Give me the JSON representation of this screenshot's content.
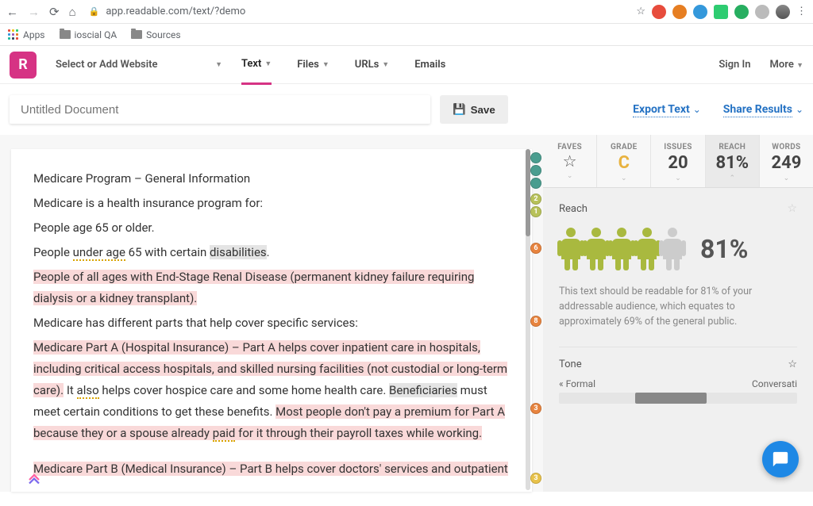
{
  "browser": {
    "url": "app.readable.com/text/?demo",
    "bookmarks": {
      "apps": "Apps",
      "item1": "ioscial QA",
      "item2": "Sources"
    }
  },
  "header": {
    "logo": "R",
    "select_website": "Select or Add Website",
    "tabs": {
      "text": "Text",
      "files": "Files",
      "urls": "URLs",
      "emails": "Emails"
    },
    "sign_in": "Sign In",
    "more": "More"
  },
  "toolbar": {
    "doc_placeholder": "Untitled Document",
    "save": "Save",
    "export": "Export Text",
    "share": "Share Results"
  },
  "editor": {
    "p1": "Medicare Program – General Information",
    "p2": "Medicare is a health insurance program for:",
    "p3": "People age 65 or older.",
    "p4a": "People ",
    "p4b": "under age",
    "p4c": " 65 with certain ",
    "p4d": "disabilities",
    "p4e": ".",
    "p5": "People of all ages with End-Stage Renal Disease (permanent kidney failure requiring dialysis or a kidney transplant).",
    "p6": "Medicare has different parts that help cover specific services:",
    "p7a": "Medicare Part A (Hospital Insurance) – Part A helps cover inpatient care in hospitals, including critical access hospitals, and skilled nursing facilities (not custodial or long-term care).",
    "p7b": " It ",
    "p7c": "also",
    "p7d": " helps cover hospice care and some home health care. ",
    "p7e": "Beneficiaries",
    "p7f": " must meet certain conditions to get these benefits. ",
    "p7g": "Most people don't pay a premium for Part A because they or a spouse already ",
    "p7h": "paid",
    "p7i": " for it through their payroll taxes while working.",
    "p8": "Medicare Part B (Medical Insurance) – Part B helps cover doctors' services and outpatient"
  },
  "markers": {
    "m1": "2",
    "m2": "1",
    "m3": "6",
    "m4": "8",
    "m5": "3",
    "m6": "3"
  },
  "metrics": {
    "faves": {
      "label": "FAVES"
    },
    "grade": {
      "label": "GRADE",
      "value": "C"
    },
    "issues": {
      "label": "ISSUES",
      "value": "20"
    },
    "reach": {
      "label": "REACH",
      "value": "81%"
    },
    "words": {
      "label": "WORDS",
      "value": "249"
    }
  },
  "reach_panel": {
    "title": "Reach",
    "pct": "81%",
    "desc": "This text should be readable for 81% of your addressable audience, which equates to approximately 69% of the general public."
  },
  "tone_panel": {
    "title": "Tone",
    "left": "« Formal",
    "right": "Conversati"
  }
}
